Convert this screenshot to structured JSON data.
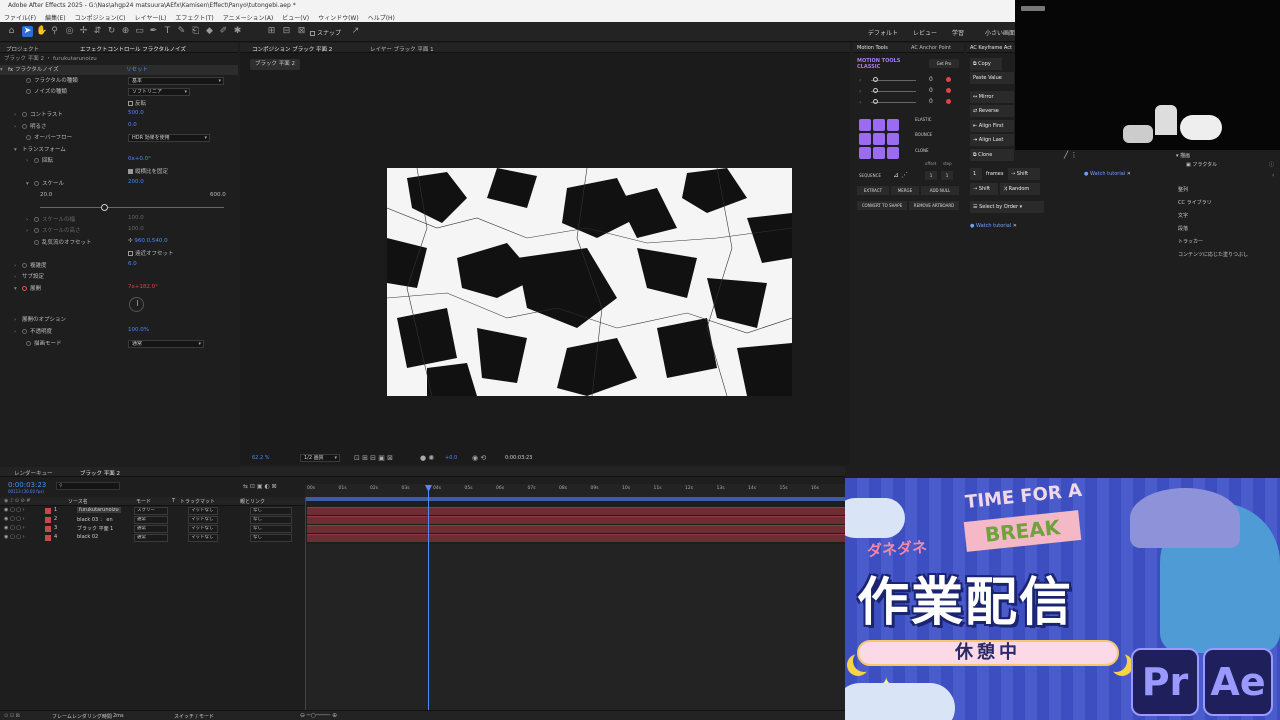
{
  "window": {
    "title": "Adobe After Effects 2025 - G:\\Nas\\ahgp24 matsuura\\AEfx\\Kamisen\\Effect\\Panyo\\tutongebi.aep *"
  },
  "menu": [
    "ファイル(F)",
    "編集(E)",
    "コンポジション(C)",
    "レイヤー(L)",
    "エフェクト(T)",
    "アニメーション(A)",
    "ビュー(V)",
    "ウィンドウ(W)",
    "ヘルプ(H)"
  ],
  "toolbar": {
    "snap_label": "スナップ",
    "workspaces": [
      "デフォルト",
      "レビュー",
      "学習",
      "小さい画面"
    ]
  },
  "left_panel": {
    "tabs": [
      "プロジェクト",
      "エフェクトコントロール フラクタルノイズ"
    ],
    "layer_path": "ブラック 平面 2 ・ furukutarunoizu",
    "effect_name": "フラクタルノイズ",
    "reset_label": "リセット",
    "props": [
      {
        "label": "フラクタルの種類",
        "value": "基本"
      },
      {
        "label": "ノイズの種類",
        "value": "ソフトリニア"
      },
      {
        "label": "反転",
        "value": ""
      },
      {
        "label": "コントラスト",
        "value": "500.0"
      },
      {
        "label": "明るさ",
        "value": "0.0"
      },
      {
        "label": "オーバーフロー",
        "value": "HDR 効果を使用"
      },
      {
        "label": "トランスフォーム",
        "value": ""
      },
      {
        "label": "回転",
        "value": "0x+0.0°"
      },
      {
        "label": "縦横比を固定",
        "value": ""
      },
      {
        "label": "スケール",
        "value": "200.0"
      },
      {
        "label": "スケールの幅",
        "value": "100.0"
      },
      {
        "label": "スケールの高さ",
        "value": "100.0"
      },
      {
        "label": "乱気流のオフセット",
        "value": "960.0,540.0"
      },
      {
        "label": "遠近オフセット",
        "value": ""
      },
      {
        "label": "複雑度",
        "value": "6.0"
      },
      {
        "label": "サブ設定",
        "value": ""
      },
      {
        "label": "展開",
        "value": "7x+182.0°"
      },
      {
        "label": "展開のオプション",
        "value": ""
      },
      {
        "label": "不透明度",
        "value": "100.0%"
      },
      {
        "label": "描画モード",
        "value": "通常"
      }
    ],
    "scale_min": "20.0",
    "scale_max": "600.0",
    "scale_slider": 0.35
  },
  "comp_panel": {
    "tabs": [
      "コンポジション ブラック 平面 2",
      "レイヤー ブラック 平面 1"
    ],
    "crumb": "ブラック 平面 2",
    "zoom": "62.2 %",
    "resolution": "1/2 画質",
    "exposure": "+0.0",
    "timecode": "0:00:03:23"
  },
  "motion_tools": {
    "tab": "Motion Tools",
    "tab2": "AC Anchor Point",
    "logo": "MOTION TOOLS CLASSIC",
    "get_pro": "Get Pro",
    "sliders": [
      "0",
      "0",
      "0"
    ],
    "elastic": "ELASTIC",
    "bounce": "BOUNCE",
    "clone": "CLONE",
    "offset_label": "offset",
    "step_label": "step",
    "sequence": "SEQUENCE",
    "offset_val": "1",
    "step_val": "1",
    "buttons": [
      "EXTRACT",
      "MERGE",
      "ADD NULL",
      "CONVERT TO SHAPE",
      "REMOVE ARTBOARD"
    ]
  },
  "ac_panel": {
    "tab": "AC Keyframe Act",
    "copy": "Copy",
    "paste": "Paste Value",
    "buttons": [
      "Mirror",
      "Reverse",
      "Align First",
      "Align Last",
      "Clone"
    ],
    "frames_val": "1",
    "frames_label": "frames",
    "shift": "Shift",
    "shift2": "Shift",
    "random": "Random",
    "select_order": "Select by Order",
    "watch": "Watch tutorial"
  },
  "right_panels": {
    "watch": "Watch tutorial",
    "effects_group": "描画",
    "effects_item": "フラクタル",
    "list": [
      "整列",
      "CC ライブラリ",
      "文字",
      "段落",
      "トラッカー",
      "コンテンツに応じた塗りつぶし"
    ]
  },
  "timeline": {
    "tabs": [
      "レンダーキュー",
      "ブラック 平面 2"
    ],
    "timecode": "0:00:03:23",
    "timecode_sub": "00113 (30.00 fps)",
    "col_source": "ソース名",
    "col_mode": "モード",
    "col_t": "T",
    "col_track": "トラックマット",
    "col_parent": "親とリンク",
    "ruler": [
      "00s",
      "01s",
      "02s",
      "03s",
      "04s",
      "05s",
      "06s",
      "07s",
      "08s",
      "09s",
      "10s",
      "11s",
      "12s",
      "13s",
      "14s",
      "15s",
      "16s"
    ],
    "layers": [
      {
        "num": "1",
        "name": "furukutarunoizu",
        "mode": "スクリー",
        "track": "マットなし",
        "parent": "なし"
      },
      {
        "num": "2",
        "name": "black 03 ： en",
        "mode": "通常",
        "track": "マットなし",
        "parent": "なし"
      },
      {
        "num": "3",
        "name": "ブラック 平面 1",
        "mode": "通常",
        "track": "マットなし",
        "parent": "なし"
      },
      {
        "num": "4",
        "name": "black 02",
        "mode": "通常",
        "track": "マットなし",
        "parent": "なし"
      }
    ],
    "footer_render": "フレームレンダリング時間",
    "footer_ms": "2ms",
    "footer_switch": "スイッチ / モード"
  },
  "overlay": {
    "time_for_a": "TIME FOR A",
    "break": "BREAK",
    "author": "ダネダネ",
    "title": "作業配信",
    "subtitle": "休憩中",
    "pr": "Pr",
    "ae": "Ae"
  },
  "colors": {
    "accent": "#2d6fd6",
    "value_blue": "#4d8bf5",
    "clip": "#6e2d33",
    "pr": "#9999ff",
    "banner_bg": "#3c4ec0"
  }
}
